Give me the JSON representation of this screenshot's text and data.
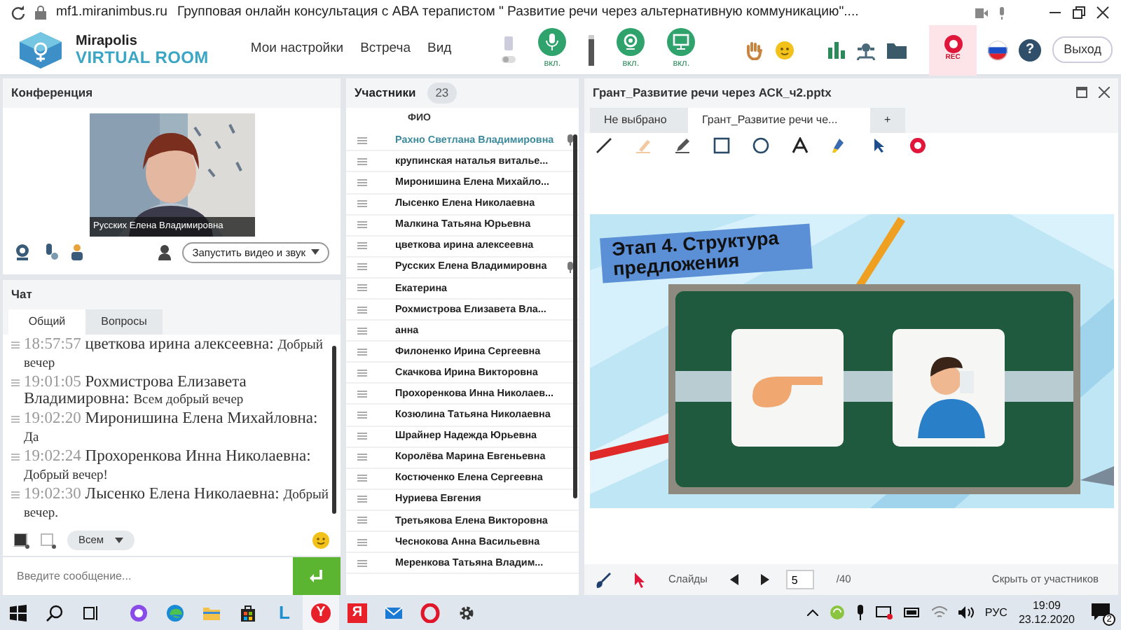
{
  "browser": {
    "url": "mf1.miranimbus.ru",
    "title": "Групповая онлайн консультация с АВА терапистом \" Развитие речи через альтернативную коммуникацию\"...."
  },
  "app": {
    "logo_top": "Mirapolis",
    "logo_bottom": "VIRTUAL ROOM",
    "menu": [
      "Мои настройки",
      "Встреча",
      "Вид"
    ],
    "media_buttons": [
      {
        "kind": "mic",
        "label": "вкл.",
        "on": true
      },
      {
        "kind": "camera",
        "label": "вкл.",
        "on": true
      },
      {
        "kind": "screen",
        "label": "вкл.",
        "on": true
      }
    ],
    "volume": {
      "level": 0.85
    },
    "rec_label": "REC",
    "help": "?",
    "exit": "Выход"
  },
  "conference": {
    "title": "Конференция",
    "video_name": "Русских Елена Владимировна",
    "start_button": "Запустить видео и звук"
  },
  "chat": {
    "title": "Чат",
    "tabs": [
      {
        "label": "Общий",
        "selected": true
      },
      {
        "label": "Вопросы",
        "selected": false
      }
    ],
    "messages": [
      {
        "time": "18:57:57",
        "author": "цветкова  ирина алексеевна:",
        "text": "Добрый вечер"
      },
      {
        "time": "19:01:05",
        "author": "Рохмистрова  Елизавета Владимировна:",
        "text": "Всем добрый вечер"
      },
      {
        "time": "19:02:20",
        "author": "Миронишина Елена Михайловна:",
        "text": "Да"
      },
      {
        "time": "19:02:24",
        "author": "Прохоренкова Инна Николаевна:",
        "text": "Добрый вечер!"
      },
      {
        "time": "19:02:30",
        "author": "Лысенко Елена  Николаевна:",
        "text": "Добрый вечер."
      }
    ],
    "recipient": "Всем",
    "placeholder": "Введите сообщение..."
  },
  "participants": {
    "title": "Участники",
    "count": "23",
    "column": "ФИО",
    "rows": [
      {
        "name": "Рахно Светлана  Владимировна",
        "selected": true,
        "mic": true
      },
      {
        "name": "крупинская  наталья виталье...",
        "selected": false,
        "mic": false
      },
      {
        "name": "Миронишина Елена   Михайло...",
        "selected": false,
        "mic": false
      },
      {
        "name": "Лысенко Елена  Николаевна",
        "selected": false,
        "mic": false
      },
      {
        "name": "Малкина Татьяна  Юрьевна",
        "selected": false,
        "mic": false
      },
      {
        "name": "цветкова  ирина алексеевна",
        "selected": false,
        "mic": false
      },
      {
        "name": "Русских Елена Владимировна",
        "selected": false,
        "mic": true
      },
      {
        "name": "Екатерина",
        "selected": false,
        "mic": false
      },
      {
        "name": "Рохмистрова  Елизавета Вла...",
        "selected": false,
        "mic": false
      },
      {
        "name": "анна",
        "selected": false,
        "mic": false
      },
      {
        "name": "Филоненко Ирина  Сергеевна",
        "selected": false,
        "mic": false
      },
      {
        "name": "Скачкова  Ирина Викторовна",
        "selected": false,
        "mic": false
      },
      {
        "name": "Прохоренкова Инна Николаев...",
        "selected": false,
        "mic": false
      },
      {
        "name": "Козюлина  Татьяна Николаевна",
        "selected": false,
        "mic": false
      },
      {
        "name": "Шрайнер Надежда  Юрьевна",
        "selected": false,
        "mic": false
      },
      {
        "name": "Королёва Марина Евгеньевна",
        "selected": false,
        "mic": false
      },
      {
        "name": "Костюченко  Елена Сергеевна",
        "selected": false,
        "mic": false
      },
      {
        "name": "Нуриева Евгения",
        "selected": false,
        "mic": false
      },
      {
        "name": "Третьякова  Елена Викторовна",
        "selected": false,
        "mic": false
      },
      {
        "name": "Чеснокова  Анна  Васильевна",
        "selected": false,
        "mic": false
      },
      {
        "name": "Меренкова  Татьяна  Владим...",
        "selected": false,
        "mic": false
      }
    ]
  },
  "presentation": {
    "title": "Грант_Развитие речи через АСК_ч2.pptx",
    "tabs": [
      {
        "label": "Не выбрано",
        "selected": false
      },
      {
        "label": "Грант_Развитие речи че...",
        "selected": true
      }
    ],
    "add_tab": "+",
    "slide": {
      "heading": "Этап 4. Структура предложения"
    },
    "slides_label": "Слайды",
    "page": "5",
    "total": "/40",
    "hide_button": "Скрыть от участников"
  },
  "taskbar": {
    "apps": [
      {
        "kind": "alice",
        "active": false
      },
      {
        "kind": "edge",
        "active": false
      },
      {
        "kind": "folder",
        "active": false
      },
      {
        "kind": "store",
        "active": false
      },
      {
        "kind": "letter",
        "glyph": "L",
        "color": "#1e90d0",
        "active": false
      },
      {
        "kind": "letter",
        "glyph": "Y",
        "color": "#e8202a",
        "active": true
      },
      {
        "kind": "letter",
        "glyph": "Я",
        "color": "#e8202a",
        "active": false
      },
      {
        "kind": "mail",
        "active": false
      },
      {
        "kind": "opera",
        "active": false
      },
      {
        "kind": "gear",
        "active": false
      }
    ],
    "lang": "РУС",
    "time": "19:09",
    "date": "23.12.2020",
    "notifications": "2"
  }
}
